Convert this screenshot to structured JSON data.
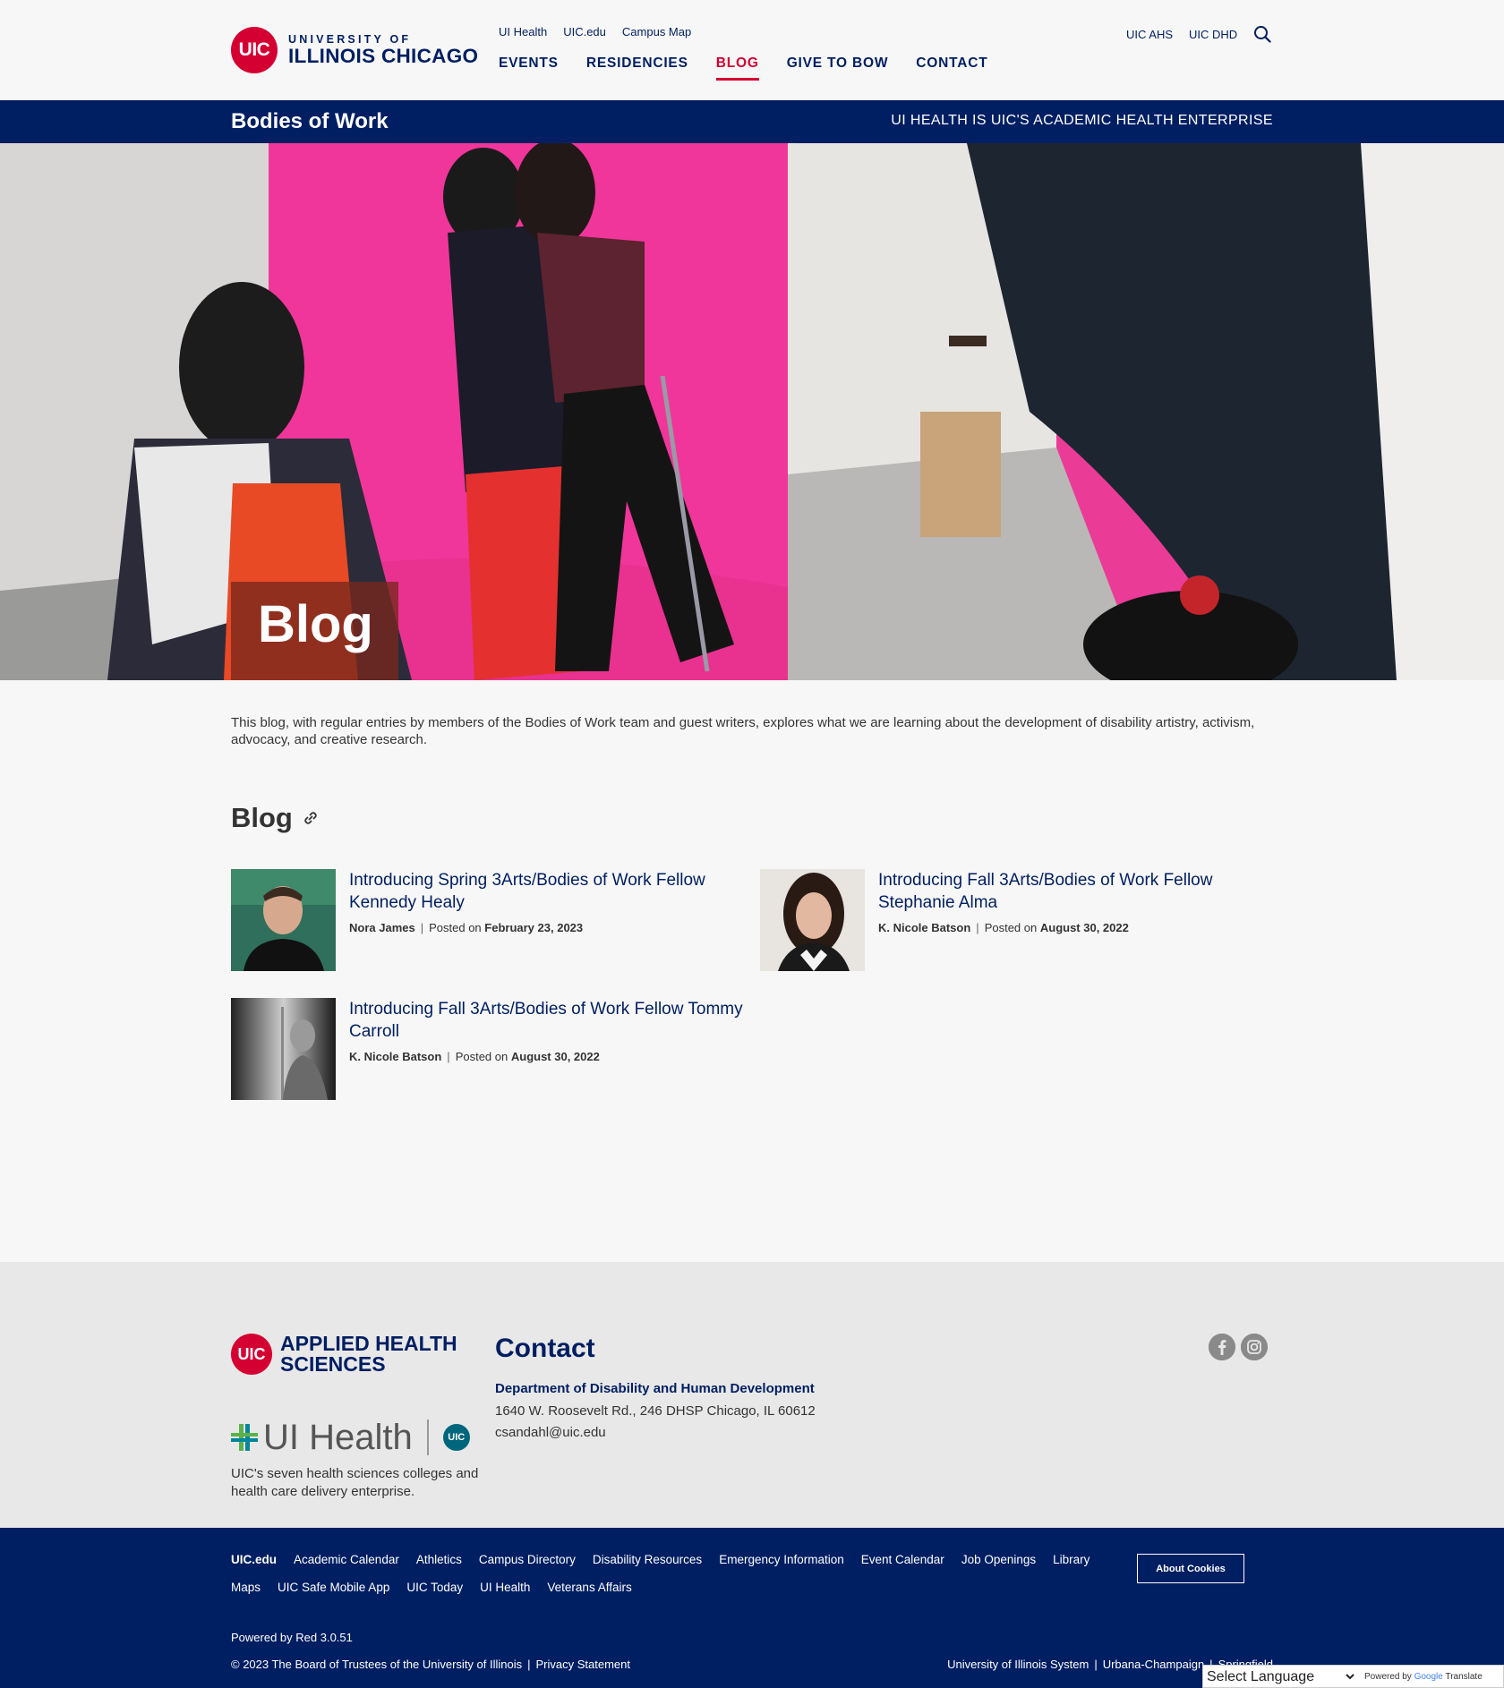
{
  "header": {
    "logo_badge": "UIC",
    "logo_line1": "UNIVERSITY OF",
    "logo_line2": "ILLINOIS CHICAGO",
    "utility_links": [
      "UI Health",
      "UIC.edu",
      "Campus Map"
    ],
    "main_nav": [
      "EVENTS",
      "RESIDENCIES",
      "BLOG",
      "GIVE TO BOW",
      "CONTACT"
    ],
    "active_nav": "BLOG",
    "utility_right": [
      "UIC AHS",
      "UIC DHD"
    ],
    "search_icon": "search-icon"
  },
  "sitebar": {
    "title": "Bodies of Work",
    "tagline": "UI HEALTH IS UIC'S ACADEMIC HEALTH ENTERPRISE"
  },
  "hero": {
    "label": "Blog"
  },
  "intro": "This blog, with regular entries by members of the Bodies of Work team and guest writers, explores what we are learning about the development of disability artistry, activism, advocacy, and creative research.",
  "blog_section": {
    "heading": "Blog",
    "link_icon": "link-icon",
    "posts": [
      {
        "title": "Introducing Spring 3Arts/Bodies of Work Fellow Kennedy Healy",
        "author": "Nora James",
        "posted_label": "Posted on",
        "date": "February 23, 2023"
      },
      {
        "title": "Introducing Fall 3Arts/Bodies of Work Fellow Stephanie Alma",
        "author": "K. Nicole Batson",
        "posted_label": "Posted on",
        "date": "August 30, 2022"
      },
      {
        "title": "Introducing Fall 3Arts/Bodies of Work Fellow Tommy Carroll",
        "author": "K. Nicole Batson",
        "posted_label": "Posted on",
        "date": "August 30, 2022"
      }
    ]
  },
  "footer": {
    "ahs_badge": "UIC",
    "ahs_name_1": "APPLIED HEALTH",
    "ahs_name_2": "SCIENCES",
    "uih_name": "UI Health",
    "uih_badge": "UIC",
    "uih_desc": "UIC's seven health sciences colleges and health care delivery enterprise.",
    "contact_heading": "Contact",
    "dept": "Department of Disability and Human Development",
    "address": "1640 W. Roosevelt Rd., 246 DHSP Chicago, IL 60612",
    "email": "csandahl@uic.edu",
    "social_icons": [
      "facebook-icon",
      "instagram-icon"
    ]
  },
  "bottom": {
    "links": [
      "UIC.edu",
      "Academic Calendar",
      "Athletics",
      "Campus Directory",
      "Disability Resources",
      "Emergency Information",
      "Event Calendar",
      "Job Openings",
      "Library",
      "Maps",
      "UIC Safe Mobile App",
      "UIC Today",
      "UI Health",
      "Veterans Affairs"
    ],
    "cookie_button": "About Cookies",
    "powered": "Powered by Red 3.0.51",
    "copyright": "© 2023 The Board of Trustees of the University of Illinois",
    "privacy": "Privacy Statement",
    "system_links": [
      "University of Illinois System",
      "Urbana-Champaign",
      "Springfield"
    ]
  },
  "translate": {
    "select_label": "Select Language",
    "powered_prefix": "Powered by",
    "google": "Google",
    "translate": "Translate"
  },
  "colors": {
    "navy": "#001e62",
    "red": "#d50032",
    "hero_pink": "#f0318f"
  }
}
